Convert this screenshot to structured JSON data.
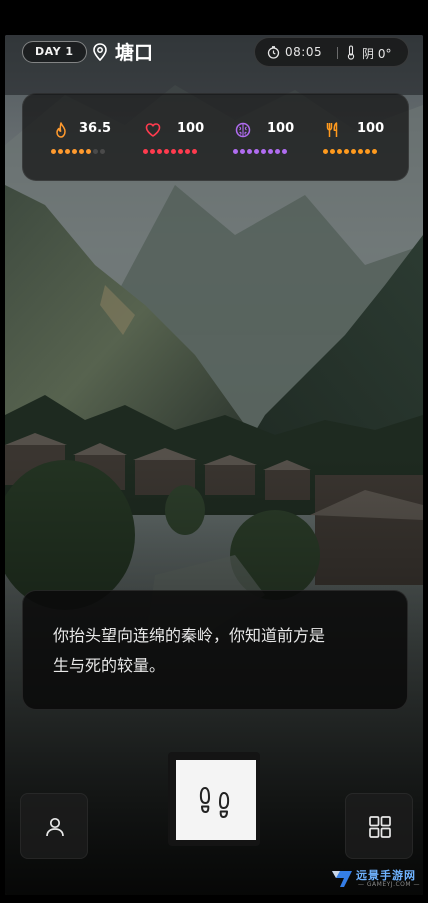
{
  "topbar": {
    "day_label": "DAY 1",
    "location_icon": "location-pin-icon",
    "location_name": "塘口",
    "time": "08:05",
    "weather": "阴 0°"
  },
  "stats": [
    {
      "name": "body-temperature",
      "icon": "flame-icon",
      "value": "36.5",
      "color": "#ff9a2e",
      "filled": 6,
      "total": 8
    },
    {
      "name": "health",
      "icon": "heart-icon",
      "value": "100",
      "color": "#ff3b4e",
      "filled": 8,
      "total": 8
    },
    {
      "name": "mind",
      "icon": "brain-icon",
      "value": "100",
      "color": "#b06cf0",
      "filled": 8,
      "total": 8
    },
    {
      "name": "food",
      "icon": "fork-knife-icon",
      "value": "100",
      "color": "#ff9a1e",
      "filled": 8,
      "total": 8
    }
  ],
  "narration": {
    "line1": "你抬头望向连绵的秦岭，你知道前方是",
    "line2": "生与死的较量。"
  },
  "buttons": {
    "character_icon": "person-icon",
    "walk_icon": "footsteps-icon",
    "menu_icon": "grid-icon"
  },
  "watermark": {
    "name": "远景手游网",
    "url": "— GAMEYJ.COM —"
  }
}
